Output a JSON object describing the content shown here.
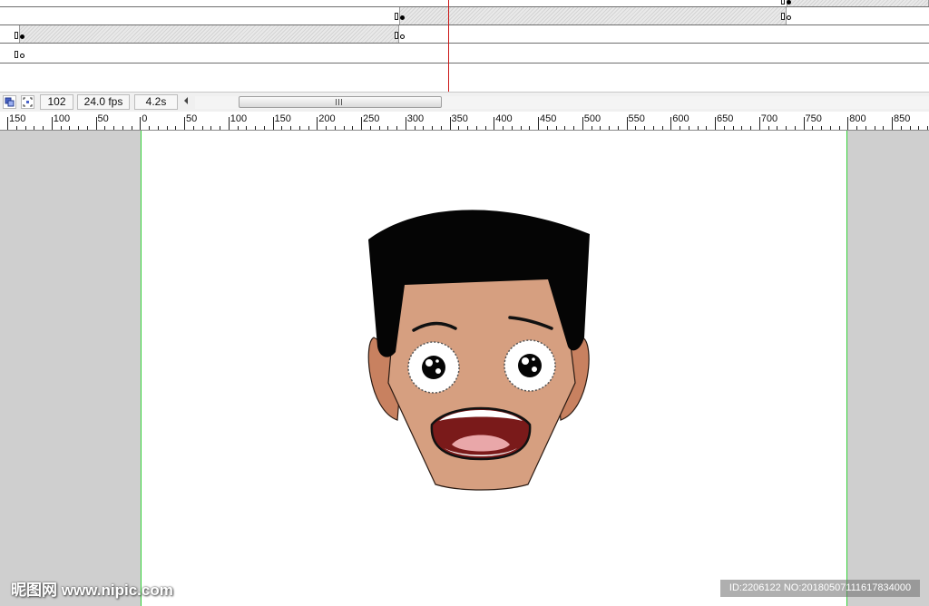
{
  "timeline": {
    "playhead_color": "#cc1a1a"
  },
  "statusbar": {
    "icons": [
      "onion-skin-icon",
      "center-frame-icon"
    ],
    "current_frame": "102",
    "frame_rate": "24.0 fps",
    "elapsed_time": "4.2s"
  },
  "ruler": {
    "labels": [
      "150",
      "100",
      "50",
      "0",
      "50",
      "100",
      "150",
      "200",
      "250",
      "300",
      "350",
      "400",
      "450",
      "500",
      "550",
      "600",
      "650",
      "700",
      "750",
      "800",
      "850"
    ]
  },
  "stage": {
    "pasteboard_color": "#cfcfcf",
    "canvas_color": "#ffffff",
    "canvas_edge_color": "#36d33a",
    "character": "cartoon-boy-head-shocked"
  },
  "watermark": {
    "left_text": "昵图网 www.nipic.com",
    "right_text": "ID:2206122 NO:20180507111617834000"
  }
}
